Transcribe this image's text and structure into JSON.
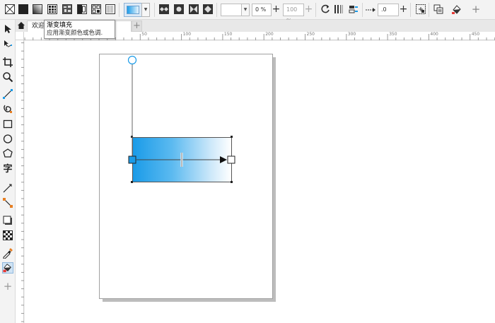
{
  "propbar": {
    "fill_types": [
      {
        "name": "no-fill",
        "icon": "no-fill-icon"
      },
      {
        "name": "uniform-fill",
        "icon": "uniform-fill-icon"
      },
      {
        "name": "fountain-fill",
        "icon": "fountain-fill-icon"
      },
      {
        "name": "vector-pattern-fill",
        "icon": "vector-pattern-icon"
      },
      {
        "name": "bitmap-pattern-fill",
        "icon": "bitmap-pattern-icon"
      },
      {
        "name": "two-color-pattern-fill",
        "icon": "two-color-pattern-icon"
      },
      {
        "name": "texture-fill",
        "icon": "texture-fill-icon"
      },
      {
        "name": "postscript-fill",
        "icon": "postscript-fill-icon"
      }
    ],
    "node_color_value": "",
    "node_transparency": "0 %",
    "node_position": "100 %",
    "angle_value": ".0"
  },
  "tooltip": {
    "title": "渐变填充",
    "description": "应用渐变颜色或色调."
  },
  "tabs": {
    "welcome_label": "欢迎"
  },
  "ruler": {
    "h_ticks": [
      "50",
      "100",
      "150",
      "200",
      "250",
      "300",
      "350",
      "400",
      "450"
    ]
  },
  "gradient": {
    "start_color": "#1a9be8",
    "end_color": "#ffffff"
  },
  "colors": {
    "accent": "#1a9be8",
    "toolbar_bg": "#f3f3f3"
  }
}
